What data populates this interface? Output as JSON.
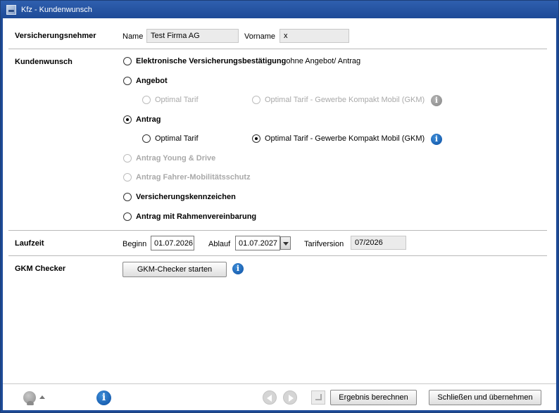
{
  "window": {
    "title": "Kfz - Kundenwunsch"
  },
  "versicherungsnehmer": {
    "section_label": "Versicherungsnehmer",
    "name_label": "Name",
    "name_value": "Test Firma AG",
    "vorname_label": "Vorname",
    "vorname_value": "x"
  },
  "kundenwunsch": {
    "section_label": "Kundenwunsch",
    "option_evb_bold": "Elektronische Versicherungsbestätigung",
    "option_evb_rest": " ohne Angebot/ Antrag",
    "option_angebot": "Angebot",
    "angebot_sub_optimal": "Optimal Tarif",
    "angebot_sub_gkm": "Optimal Tarif - Gewerbe Kompakt Mobil (GKM)",
    "option_antrag": "Antrag",
    "antrag_sub_optimal": "Optimal Tarif",
    "antrag_sub_gkm": "Optimal Tarif - Gewerbe Kompakt Mobil (GKM)",
    "option_young_drive": "Antrag Young & Drive",
    "option_fahrer": "Antrag Fahrer-Mobilitätsschutz",
    "option_kennzeichen": "Versicherungskennzeichen",
    "option_rahmen": "Antrag mit Rahmenvereinbarung",
    "selected": "Antrag",
    "selected_sub": "Optimal Tarif - Gewerbe Kompakt Mobil (GKM)"
  },
  "laufzeit": {
    "section_label": "Laufzeit",
    "beginn_label": "Beginn",
    "beginn_value": "01.07.2026",
    "ablauf_label": "Ablauf",
    "ablauf_value": "01.07.2027",
    "tarifversion_label": "Tarifversion",
    "tarifversion_value": "07/2026"
  },
  "gkm": {
    "section_label": "GKM Checker",
    "button_label": "GKM-Checker starten"
  },
  "footer": {
    "ergebnis_label": "Ergebnis berechnen",
    "schliessen_label": "Schließen und übernehmen"
  },
  "colors": {
    "titlebar": "#1d4a97",
    "info_blue": "#0b4ea2",
    "disabled_text": "#a9a9a9"
  },
  "icons": [
    "app-icon",
    "info-icon",
    "avatar-icon",
    "prev-icon",
    "next-icon",
    "jump-icon"
  ]
}
